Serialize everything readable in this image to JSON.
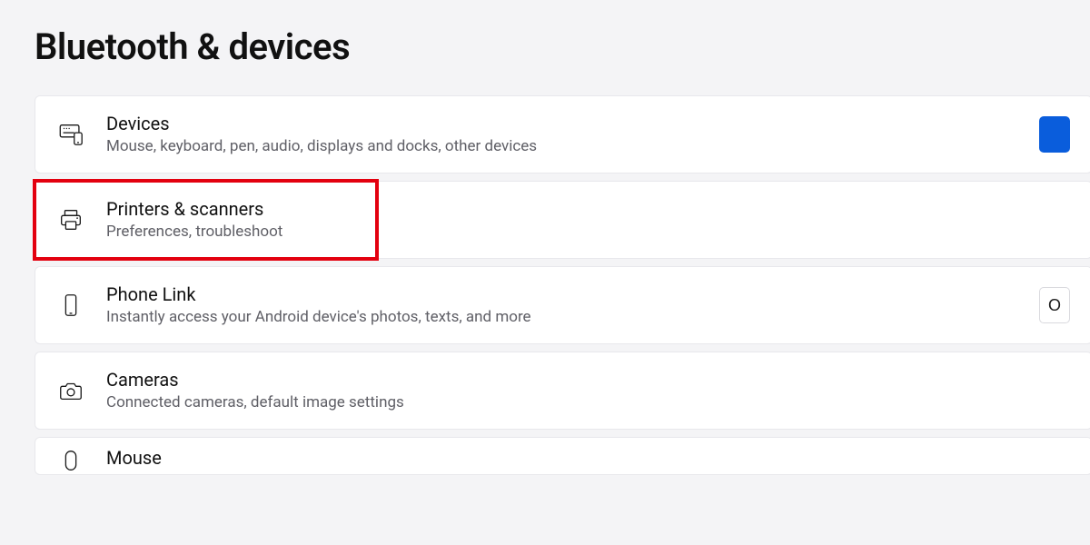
{
  "page": {
    "title": "Bluetooth & devices"
  },
  "rows": {
    "devices": {
      "title": "Devices",
      "sub": "Mouse, keyboard, pen, audio, displays and docks, other devices"
    },
    "printers": {
      "title": "Printers & scanners",
      "sub": "Preferences, troubleshoot"
    },
    "phone": {
      "title": "Phone Link",
      "sub": "Instantly access your Android device's photos, texts, and more",
      "action_label": "O"
    },
    "cameras": {
      "title": "Cameras",
      "sub": "Connected cameras, default image settings"
    },
    "mouse": {
      "title": "Mouse"
    }
  }
}
